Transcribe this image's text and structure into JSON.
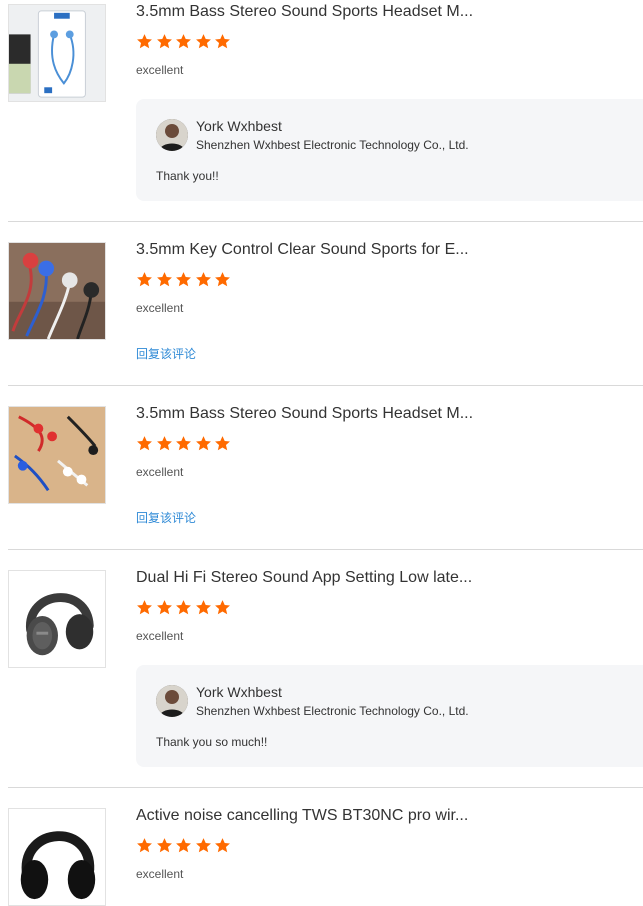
{
  "reviews": [
    {
      "title": "3.5mm Bass Stereo Sound Sports Headset M...",
      "rating": 5,
      "rating_text": "excellent",
      "thumb_icon": "boxed-earphones-image",
      "seller_reply": {
        "name": "York Wxhbest",
        "company": "Shenzhen Wxhbest Electronic Technology Co., Ltd.",
        "text": "Thank you!!"
      }
    },
    {
      "title": "3.5mm Key Control Clear Sound Sports for E...",
      "rating": 5,
      "rating_text": "excellent",
      "thumb_icon": "metal-earphones-image",
      "reply_link": "回复该评论"
    },
    {
      "title": "3.5mm Bass Stereo Sound Sports Headset M...",
      "rating": 5,
      "rating_text": "excellent",
      "thumb_icon": "colored-earphones-image",
      "reply_link": "回复该评论"
    },
    {
      "title": "Dual Hi Fi Stereo Sound App Setting Low late...",
      "rating": 5,
      "rating_text": "excellent",
      "thumb_icon": "gray-headphones-image",
      "seller_reply": {
        "name": "York Wxhbest",
        "company": "Shenzhen Wxhbest Electronic Technology Co., Ltd.",
        "text": "Thank you so much!!"
      }
    },
    {
      "title": "Active noise cancelling TWS BT30NC pro wir...",
      "rating": 5,
      "rating_text": "excellent",
      "thumb_icon": "black-headphones-image"
    }
  ],
  "colors": {
    "star": "#ff6a00",
    "link": "#2f8ad6",
    "reply_bg": "#f5f6f8",
    "divider": "#d9d9d9"
  }
}
